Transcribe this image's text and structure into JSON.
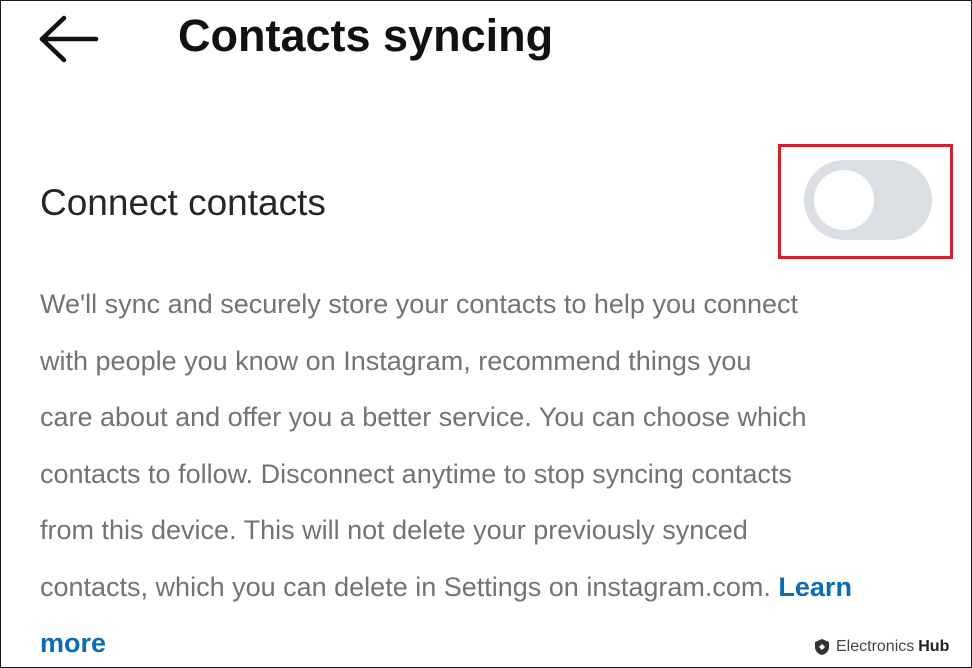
{
  "header": {
    "back_icon": "arrow-left-icon",
    "title": "Contacts syncing"
  },
  "setting": {
    "label": "Connect contacts",
    "toggle_state": "off",
    "toggle_track_color": "#dbdfe4",
    "highlight_color": "#d0202e"
  },
  "description": {
    "lines": [
      "We'll sync and securely store your contacts to help you connect",
      "with people you know on Instagram, recommend things you",
      "care about and offer you a better service. You can choose which",
      "contacts to follow. Disconnect anytime to stop syncing contacts",
      "from this device. This will not delete your previously synced",
      "contacts, which you can delete in Settings on instagram.com."
    ],
    "link_part1": "Learn",
    "link_part2": "more",
    "link_color": "#0b6cb3"
  },
  "watermark": {
    "icon": "shield-logo-icon",
    "text": "Electronics",
    "text_bold": "Hub"
  }
}
